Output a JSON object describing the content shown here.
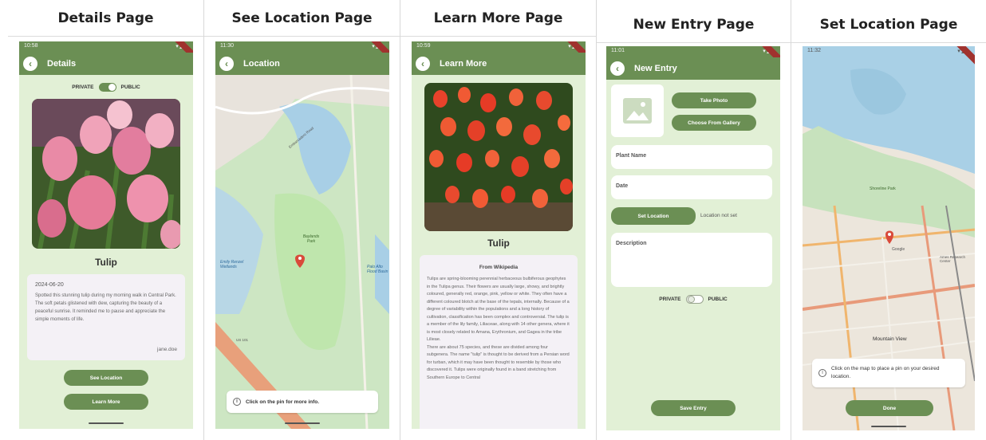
{
  "panels": {
    "details": "Details Page",
    "see_location": "See Location Page",
    "learn_more": "Learn More Page",
    "new_entry": "New Entry Page",
    "set_location": "Set Location Page"
  },
  "details": {
    "time": "10:58",
    "title": "Details",
    "private_label": "PRIVATE",
    "public_label": "PUBLIC",
    "plant": "Tulip",
    "date": "2024-06-20",
    "description": "Spotted this stunning tulip during my morning walk in Central Park. The soft petals glistened with dew, capturing the beauty of a peaceful sunrise. It reminded me to pause and appreciate the simple moments of life.",
    "author": "jane.doe",
    "see_location_btn": "See Location",
    "learn_more_btn": "Learn More"
  },
  "see_location": {
    "time": "11:30",
    "title": "Location",
    "map_park_label": "Baylands Park",
    "map_lake_label": "Emily Renzel Wetlands",
    "map_road_label": "Embarcadero Road",
    "map_right_label": "Palo Alto Flood Basin",
    "map_road_number": "US 101",
    "info": "Click on the pin for more info."
  },
  "learn_more": {
    "time": "10:59",
    "title": "Learn More",
    "plant": "Tulip",
    "source": "From Wikipedia",
    "paragraph1": "Tulips are spring-blooming perennial herbaceous bulbiferous geophytes in the Tulipa genus. Their flowers are usually large, showy, and brightly coloured, generally red, orange, pink, yellow or white. They often have a different coloured blotch at the base of the tepals, internally. Because of a degree of variability within the populations and a long history of cultivation, classification has been complex and controversial. The tulip is a member of the lily family, Liliaceae, along with 14 other genera, where it is most closely related to Amana, Erythronium, and Gagea in the tribe Lilieae.",
    "paragraph2": "There are about 75 species, and these are divided among four subgenera. The name \"tulip\" is thought to be derived from a Persian word for turban, which it may have been thought to resemble by those who discovered it. Tulips were originally found in a band stretching from Southern Europe to Central"
  },
  "new_entry": {
    "time": "11:01",
    "title": "New Entry",
    "take_photo_btn": "Take Photo",
    "gallery_btn": "Choose From Gallery",
    "plant_name_placeholder": "Plant Name",
    "date_placeholder": "Date",
    "set_location_btn": "Set Location",
    "location_status": "Location not set",
    "description_placeholder": "Description",
    "private_label": "PRIVATE",
    "public_label": "PUBLIC",
    "save_btn": "Save Entry"
  },
  "set_location": {
    "time": "11:32",
    "map_city_label": "Mountain View",
    "map_poi_label": "Shoreline Park",
    "map_google_label": "Google",
    "map_research_label": "Ames Research Center",
    "info": "Click on the map to place a pin on your desired location.",
    "done_btn": "Done"
  },
  "colors": {
    "primary": "#6b8f54",
    "background": "#e2f0d6",
    "pin": "#d94a3a"
  }
}
